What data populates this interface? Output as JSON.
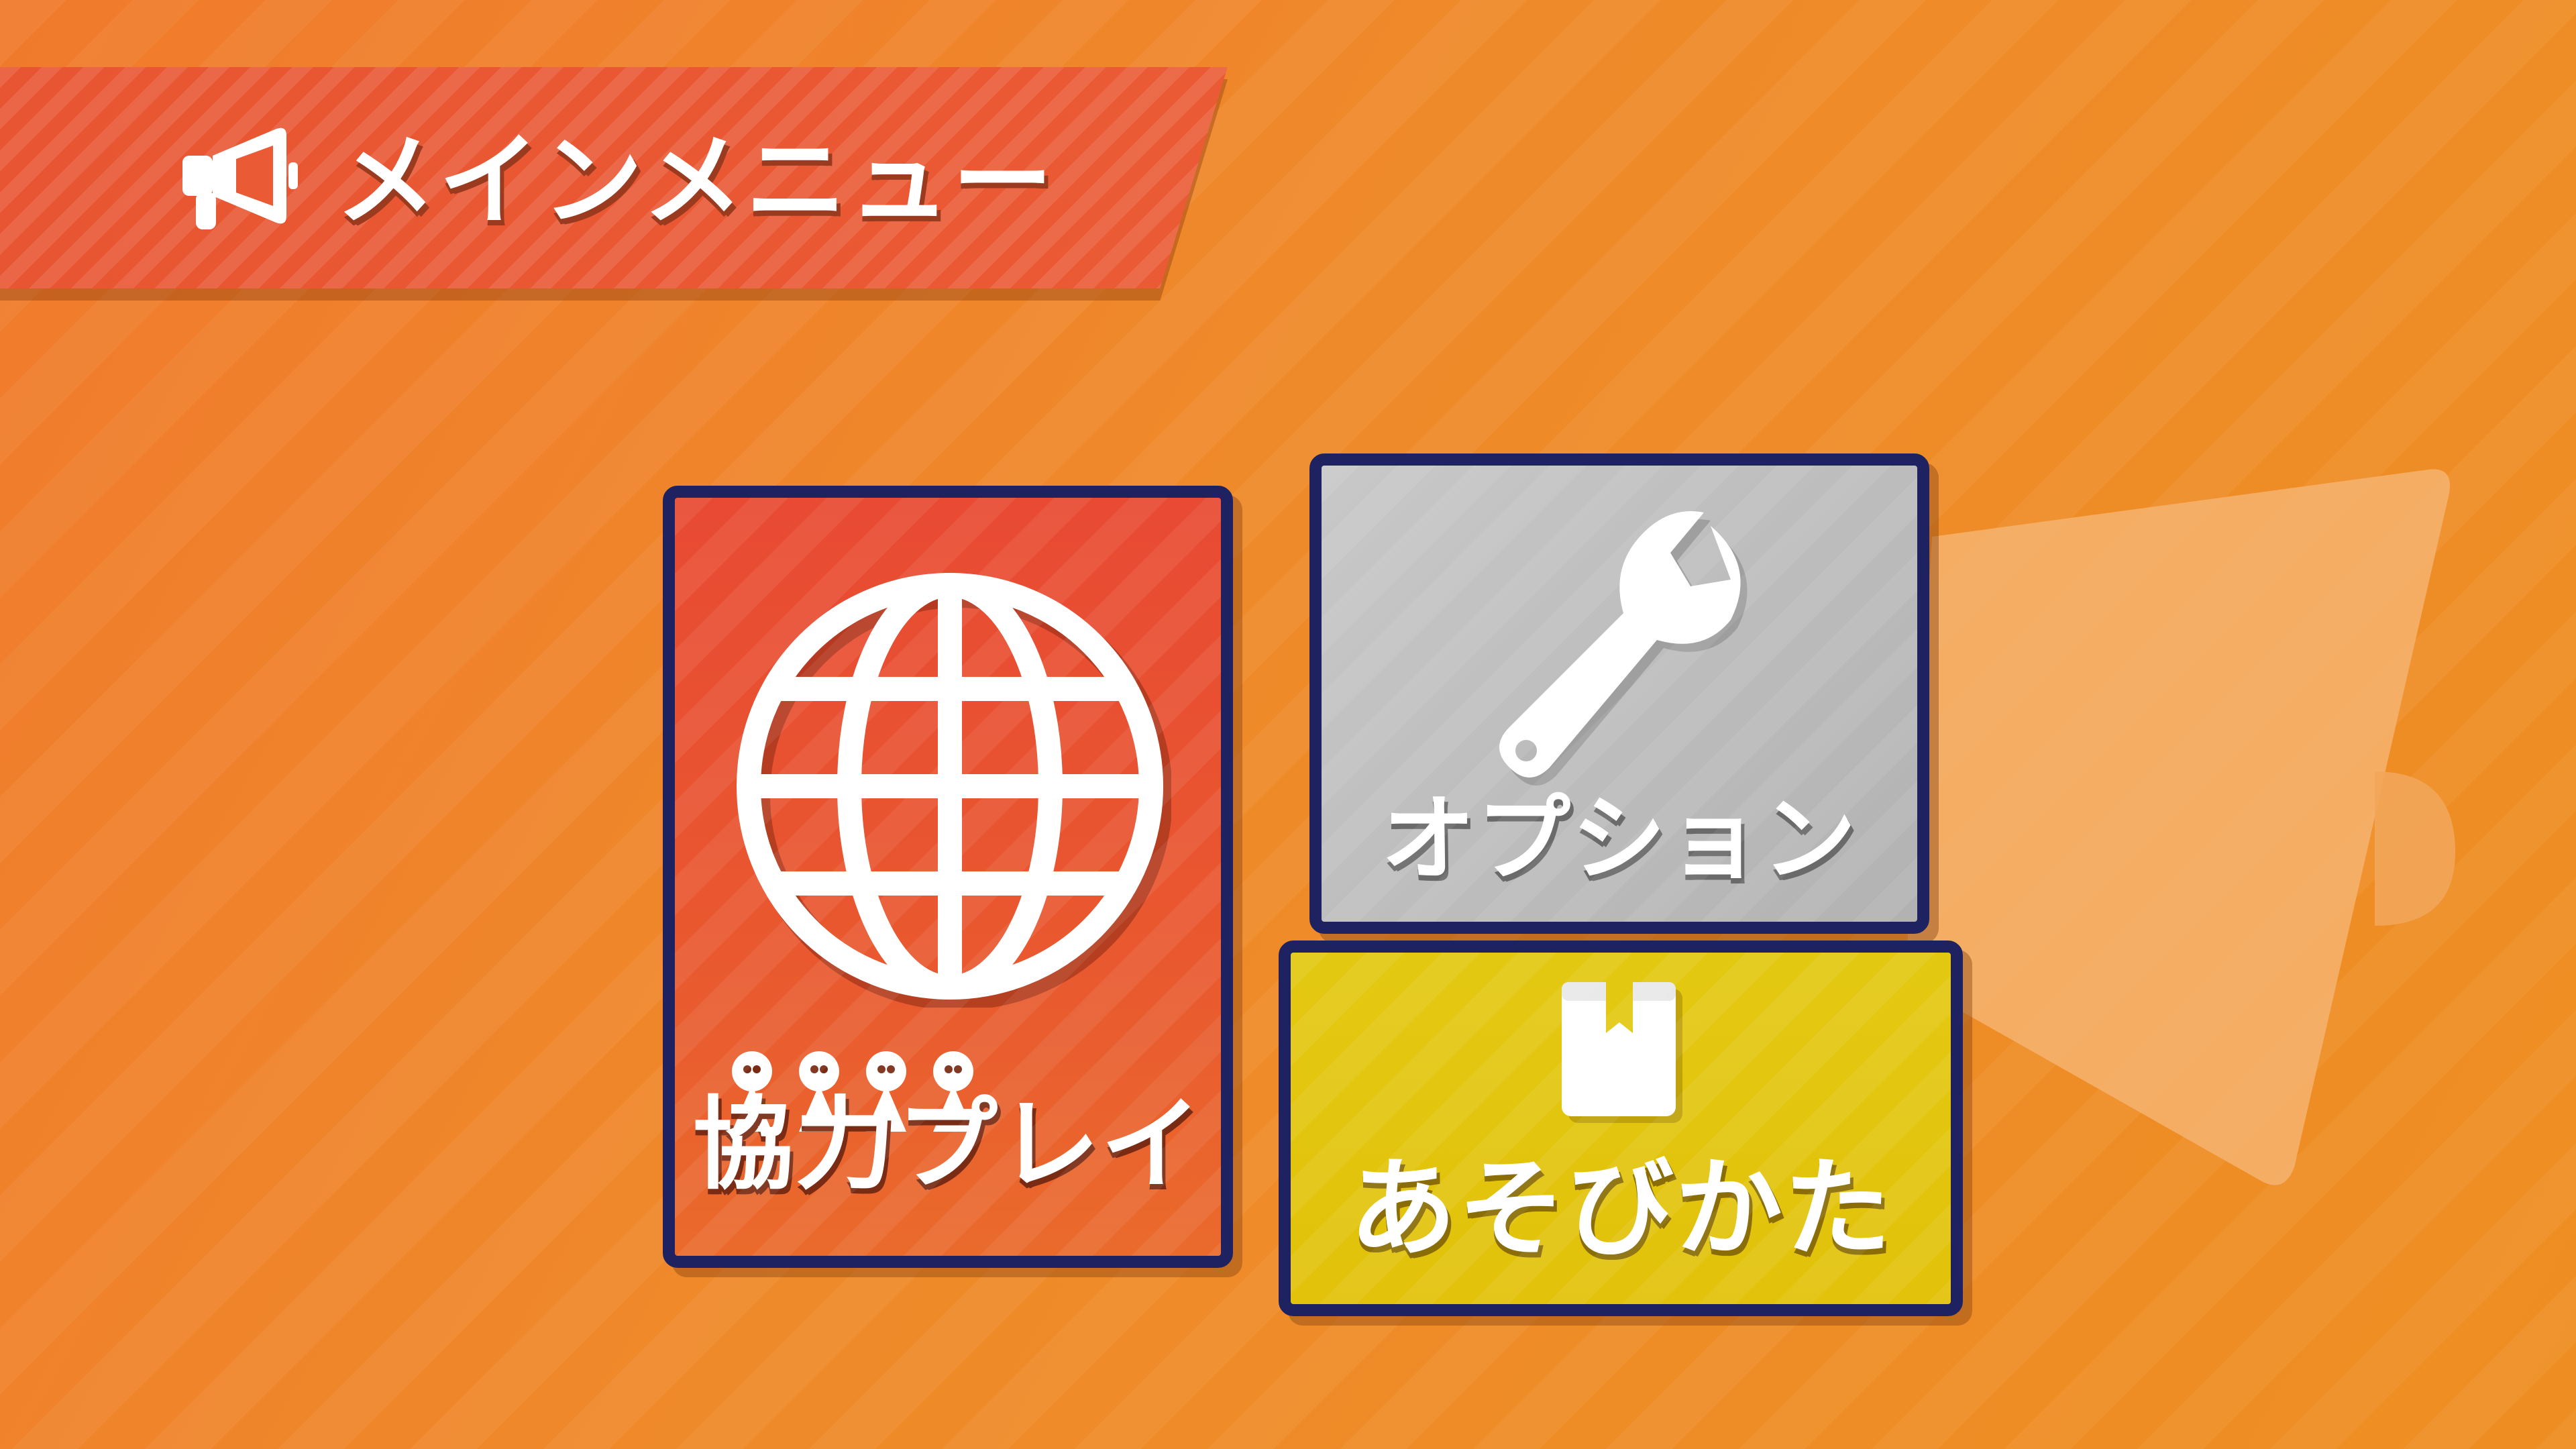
{
  "header": {
    "title": "メインメニュー",
    "icon": "megaphone-icon"
  },
  "menu": {
    "coop": {
      "label": "協力プレイ",
      "icon": "globe-icon",
      "color": "#e84a33"
    },
    "options": {
      "label": "オプション",
      "icon": "wrench-icon",
      "color": "#bdbdbd"
    },
    "howto": {
      "label": "あそびかた",
      "icon": "book-icon",
      "color": "#e3c812"
    }
  },
  "colors": {
    "background": "#ef8a2a",
    "border": "#1e2260"
  }
}
